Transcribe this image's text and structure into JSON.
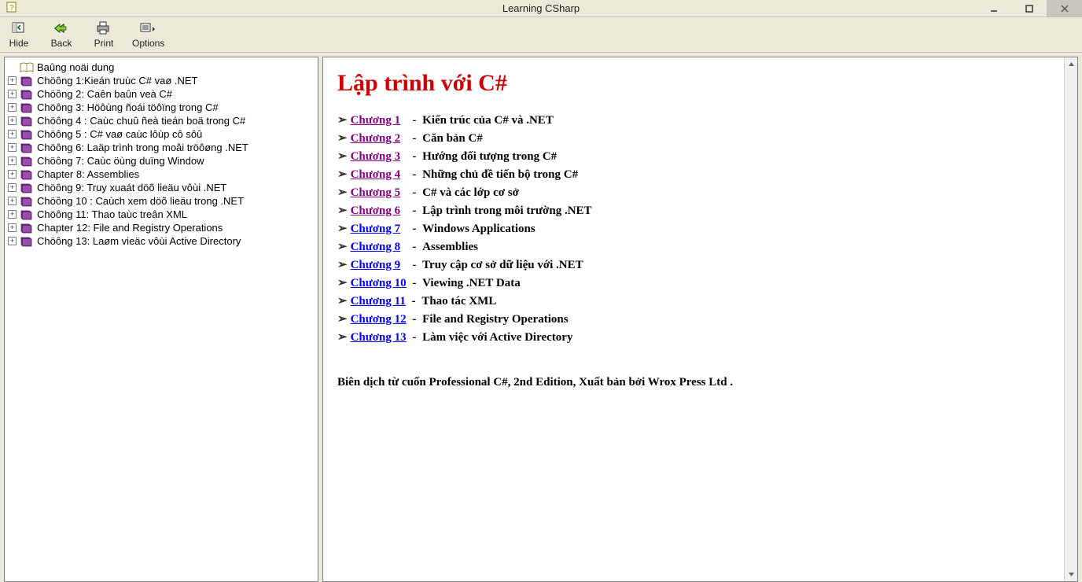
{
  "window": {
    "title": "Learning CSharp"
  },
  "toolbar": {
    "hide": "Hide",
    "back": "Back",
    "print": "Print",
    "options": "Options"
  },
  "tree": {
    "root_label": "Baûng noäi dung",
    "items": [
      {
        "label": "Chöông 1:Kieán truùc C# vaø .NET"
      },
      {
        "label": "Chöông 2: Caên baûn  veà C#"
      },
      {
        "label": "Chöông 3: Höôùng ñoái töôïng trong C#"
      },
      {
        "label": "Chöông 4 : Caùc chuû ñeà tieán boä trong C#"
      },
      {
        "label": "Chöông 5 : C# vaø caùc lôùp cô sôû"
      },
      {
        "label": "Chöông 6: Laäp trình trong moâi tröôøng .NET"
      },
      {
        "label": "Chöông 7: Caùc öùng duïng Window"
      },
      {
        "label": "Chapter 8: Assemblies"
      },
      {
        "label": "Chöông 9: Truy xuaát döõ lieäu vôùi .NET"
      },
      {
        "label": "Chöông 10 : Caùch xem döõ lieäu trong .NET"
      },
      {
        "label": "Chöông 11: Thao taùc treân XML"
      },
      {
        "label": "Chapter 12: File and Registry Operations"
      },
      {
        "label": "Chöông 13: Laøm vieäc vôùi Active Directory"
      }
    ]
  },
  "content": {
    "heading": "Lập trình với  C#",
    "chapters": [
      {
        "link": "Chương 1",
        "sep": "   - ",
        "desc": "Kiến trúc của C# và .NET",
        "visited": true
      },
      {
        "link": "Chương 2",
        "sep": "   - ",
        "desc": "Căn bản C#",
        "visited": true
      },
      {
        "link": "Chương 3",
        "sep": "   - ",
        "desc": "Hướng đối tượng trong  C#",
        "visited": true
      },
      {
        "link": "Chương 4",
        "sep": "   - ",
        "desc": "Những chủ đề tiến bộ trong C#",
        "visited": true
      },
      {
        "link": "Chương 5",
        "sep": "   - ",
        "desc": "C# và các lớp cơ sở",
        "visited": true
      },
      {
        "link": "Chương 6",
        "sep": "   - ",
        "desc": "Lập trình trong môi trường .NET",
        "visited": true
      },
      {
        "link": "Chương 7",
        "sep": "   - ",
        "desc": "Windows Applications",
        "visited": false
      },
      {
        "link": "Chương 8",
        "sep": "   - ",
        "desc": "Assemblies",
        "visited": false
      },
      {
        "link": "Chương 9",
        "sep": "   - ",
        "desc": "Truy cập cơ sở dữ liệu với .NET",
        "visited": false
      },
      {
        "link": "Chương 10",
        "sep": " - ",
        "desc": "Viewing .NET Data",
        "visited": false
      },
      {
        "link": "Chương 11",
        "sep": " - ",
        "desc": "Thao tác XML",
        "visited": false
      },
      {
        "link": "Chương 12",
        "sep": " - ",
        "desc": "File and Registry Operations",
        "visited": false
      },
      {
        "link": "Chương 13",
        "sep": " - ",
        "desc": "Làm việc với  Active Directory",
        "visited": false
      }
    ],
    "footer": "Biên dịch từ cuốn  Professional C#, 2nd Edition, Xuất bản bởi Wrox Press Ltd ."
  }
}
